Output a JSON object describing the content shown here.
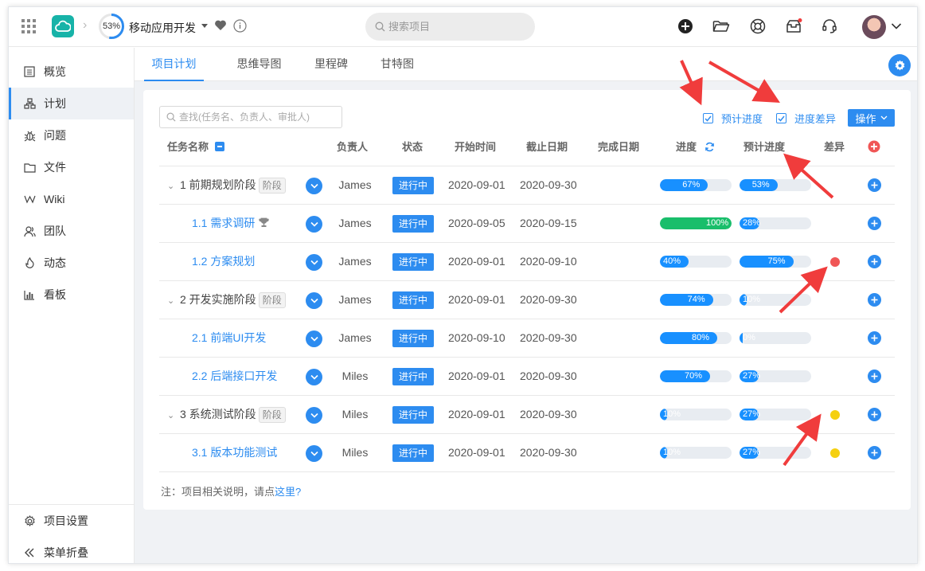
{
  "header": {
    "progress_label": "53%",
    "progress_value": 53,
    "project_name": "移动应用开发",
    "search_placeholder": "搜索项目"
  },
  "sidebar": {
    "items": [
      {
        "label": "概览",
        "icon": "list-icon"
      },
      {
        "label": "计划",
        "icon": "hierarchy-icon",
        "active": true
      },
      {
        "label": "问题",
        "icon": "bug-icon"
      },
      {
        "label": "文件",
        "icon": "folder-icon"
      },
      {
        "label": "Wiki",
        "icon": "wiki-icon"
      },
      {
        "label": "团队",
        "icon": "team-icon"
      },
      {
        "label": "动态",
        "icon": "flame-icon"
      },
      {
        "label": "看板",
        "icon": "bar-chart-icon"
      }
    ],
    "settings_label": "项目设置",
    "collapse_label": "菜单折叠"
  },
  "tabs": [
    "项目计划",
    "思维导图",
    "里程碑",
    "甘特图"
  ],
  "toolbar": {
    "find_placeholder": "查找(任务名、负责人、审批人)",
    "check_expected": "预计进度",
    "check_diff": "进度差异",
    "op_label": "操作"
  },
  "columns": {
    "name": "任务名称",
    "owner": "负责人",
    "status": "状态",
    "start": "开始时间",
    "due": "截止日期",
    "done": "完成日期",
    "progress": "进度",
    "expected": "预计进度",
    "diff": "差异"
  },
  "rows": [
    {
      "name": "1 前期规划阶段",
      "phase": true,
      "tag": "阶段",
      "owner": "James",
      "status": "进行中",
      "start": "2020-09-01",
      "due": "2020-09-30",
      "progress": 67,
      "progress_label": "67%",
      "expected": 53,
      "expected_label": "53%",
      "diff": null
    },
    {
      "name": "1.1 需求调研",
      "phase": false,
      "trophy": true,
      "owner": "James",
      "status": "进行中",
      "start": "2020-09-05",
      "due": "2020-09-15",
      "progress": 100,
      "progress_label": "100%",
      "expected": 28,
      "expected_label": "28%",
      "diff": null
    },
    {
      "name": "1.2 方案规划",
      "phase": false,
      "owner": "James",
      "status": "进行中",
      "start": "2020-09-01",
      "due": "2020-09-10",
      "progress": 40,
      "progress_label": "40%",
      "expected": 75,
      "expected_label": "75%",
      "diff": "#f05656"
    },
    {
      "name": "2 开发实施阶段",
      "phase": true,
      "tag": "阶段",
      "owner": "James",
      "status": "进行中",
      "start": "2020-09-01",
      "due": "2020-09-30",
      "progress": 74,
      "progress_label": "74%",
      "expected": 10,
      "expected_label": "10%",
      "diff": null
    },
    {
      "name": "2.1 前端UI开发",
      "phase": false,
      "owner": "James",
      "status": "进行中",
      "start": "2020-09-10",
      "due": "2020-09-30",
      "progress": 80,
      "progress_label": "80%",
      "expected": 0,
      "expected_label": "0%",
      "diff": null
    },
    {
      "name": "2.2 后端接口开发",
      "phase": false,
      "owner": "Miles",
      "status": "进行中",
      "start": "2020-09-01",
      "due": "2020-09-30",
      "progress": 70,
      "progress_label": "70%",
      "expected": 27,
      "expected_label": "27%",
      "diff": null
    },
    {
      "name": "3 系统测试阶段",
      "phase": true,
      "tag": "阶段",
      "owner": "Miles",
      "status": "进行中",
      "start": "2020-09-01",
      "due": "2020-09-30",
      "progress": 10,
      "progress_label": "10%",
      "expected": 27,
      "expected_label": "27%",
      "diff": "#f5d010"
    },
    {
      "name": "3.1 版本功能测试",
      "phase": false,
      "owner": "Miles",
      "status": "进行中",
      "start": "2020-09-01",
      "due": "2020-09-30",
      "progress": 10,
      "progress_label": "10%",
      "expected": 27,
      "expected_label": "27%",
      "diff": "#f5d010"
    }
  ],
  "note": {
    "prefix": "注：项目相关说明，请点",
    "link": "这里?"
  },
  "colors": {
    "accent": "#2d8cf0",
    "complete": "#19be6b",
    "annotation_arrow": "#f03c3c"
  }
}
